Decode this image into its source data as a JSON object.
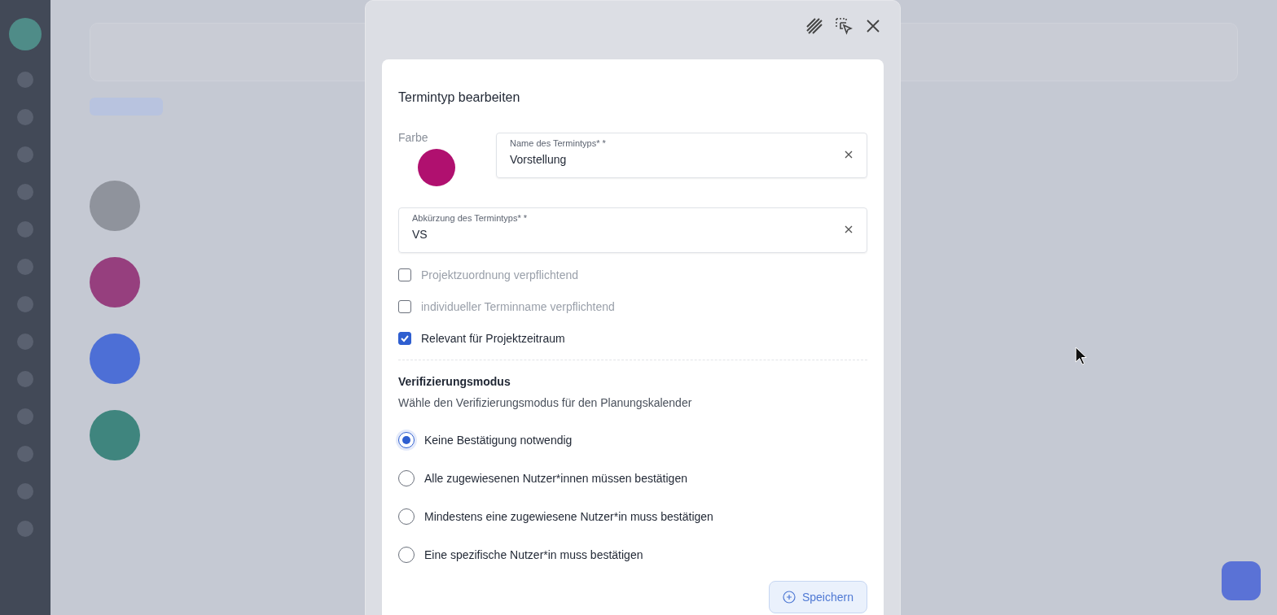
{
  "background_types": [
    {
      "color": "#8f939c"
    },
    {
      "color": "#963f7e"
    },
    {
      "color": "#4d6fd6"
    },
    {
      "color": "#3f857e"
    }
  ],
  "dialog": {
    "title": "Termintyp bearbeiten",
    "color_label": "Farbe",
    "color": "#b0106f",
    "fields": [
      {
        "label": "Name des Termintyps* *",
        "value": "Vorstellung"
      },
      {
        "label": "Abkürzung des Termintyps* *",
        "value": "VS"
      }
    ],
    "checkboxes": [
      {
        "label": "Projektzuordnung verpflichtend",
        "checked": false
      },
      {
        "label": "individueller Terminname verpflichtend",
        "checked": false
      },
      {
        "label": "Relevant für Projektzeitraum",
        "checked": true
      }
    ],
    "verification": {
      "title": "Verifizierungsmodus",
      "description": "Wähle den Verifizierungsmodus für den Planungskalender",
      "options": [
        {
          "label": "Keine Bestätigung notwendig",
          "selected": true
        },
        {
          "label": "Alle zugewiesenen Nutzer*innen müssen bestätigen",
          "selected": false
        },
        {
          "label": "Mindestens eine zugewiesene Nutzer*in muss bestätigen",
          "selected": false
        },
        {
          "label": "Eine spezifische Nutzer*in muss bestätigen",
          "selected": false
        }
      ]
    },
    "save_button": "Speichern"
  }
}
